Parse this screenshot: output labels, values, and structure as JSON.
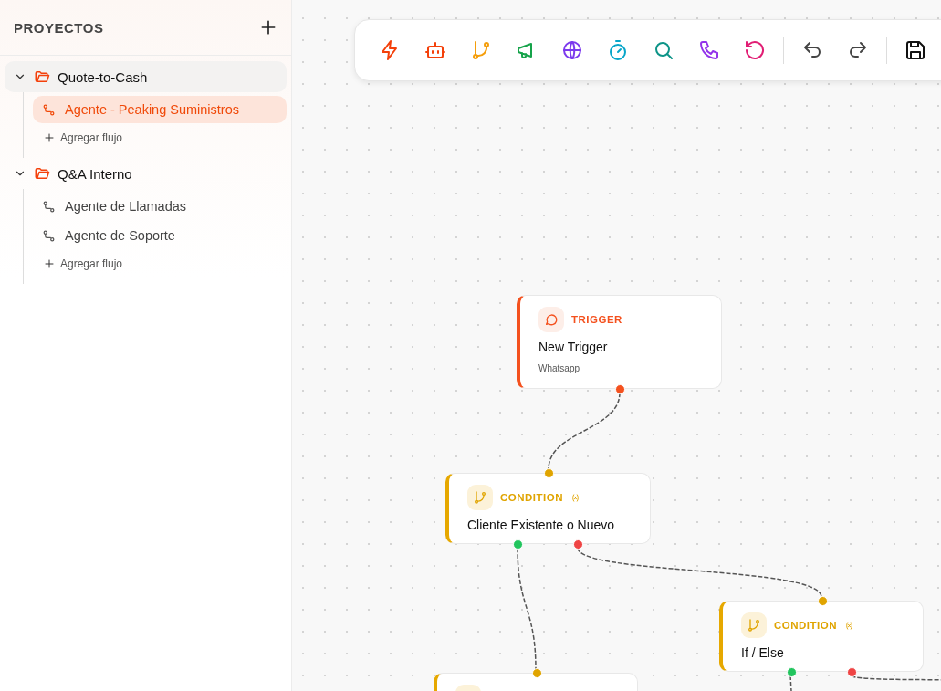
{
  "sidebar": {
    "title": "PROYECTOS",
    "projects": [
      {
        "name": "Quote-to-Cash",
        "expanded": true,
        "flows": [
          {
            "name": "Agente - Peaking Suministros",
            "selected": true
          }
        ],
        "add_label": "Agregar flujo"
      },
      {
        "name": "Q&A Interno",
        "expanded": true,
        "flows": [
          {
            "name": "Agente de Llamadas",
            "selected": false
          },
          {
            "name": "Agente de Soporte",
            "selected": false
          }
        ],
        "add_label": "Agregar flujo"
      }
    ]
  },
  "nodes": [
    {
      "kind": "trigger",
      "type_label": "TRIGGER",
      "title": "New Trigger",
      "subtitle": "Whatsapp"
    },
    {
      "kind": "condition",
      "type_label": "CONDITION",
      "title": "Cliente Existente o Nuevo"
    },
    {
      "kind": "condition",
      "type_label": "CONDITION",
      "title": "If / Else"
    },
    {
      "kind": "condition"
    }
  ]
}
